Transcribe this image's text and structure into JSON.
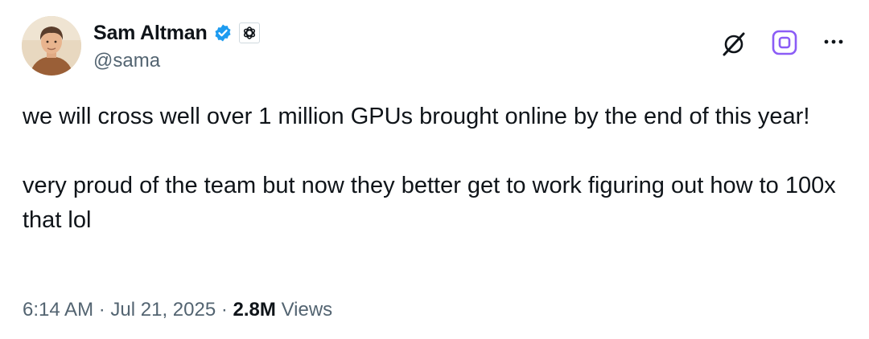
{
  "author": {
    "display_name": "Sam Altman",
    "handle": "@sama",
    "verified": true,
    "affiliation_badge_icon": "openai-logo-icon"
  },
  "header_actions": [
    {
      "icon": "grok-icon"
    },
    {
      "icon": "subscribe-icon"
    },
    {
      "icon": "more-icon"
    }
  ],
  "tweet": {
    "paragraphs": [
      "we will cross well over 1 million GPUs brought online by the end of this year!",
      "very proud of the team but now they better get to work figuring out how to 100x that lol"
    ]
  },
  "meta": {
    "time": "6:14 AM",
    "separator": "·",
    "date": "Jul 21, 2025",
    "views_count": "2.8M",
    "views_label": "Views"
  },
  "colors": {
    "text_primary": "#0f1419",
    "text_secondary": "#536471",
    "verified_blue": "#1d9bf0",
    "subscribe_purple": "#8b5cf6"
  }
}
